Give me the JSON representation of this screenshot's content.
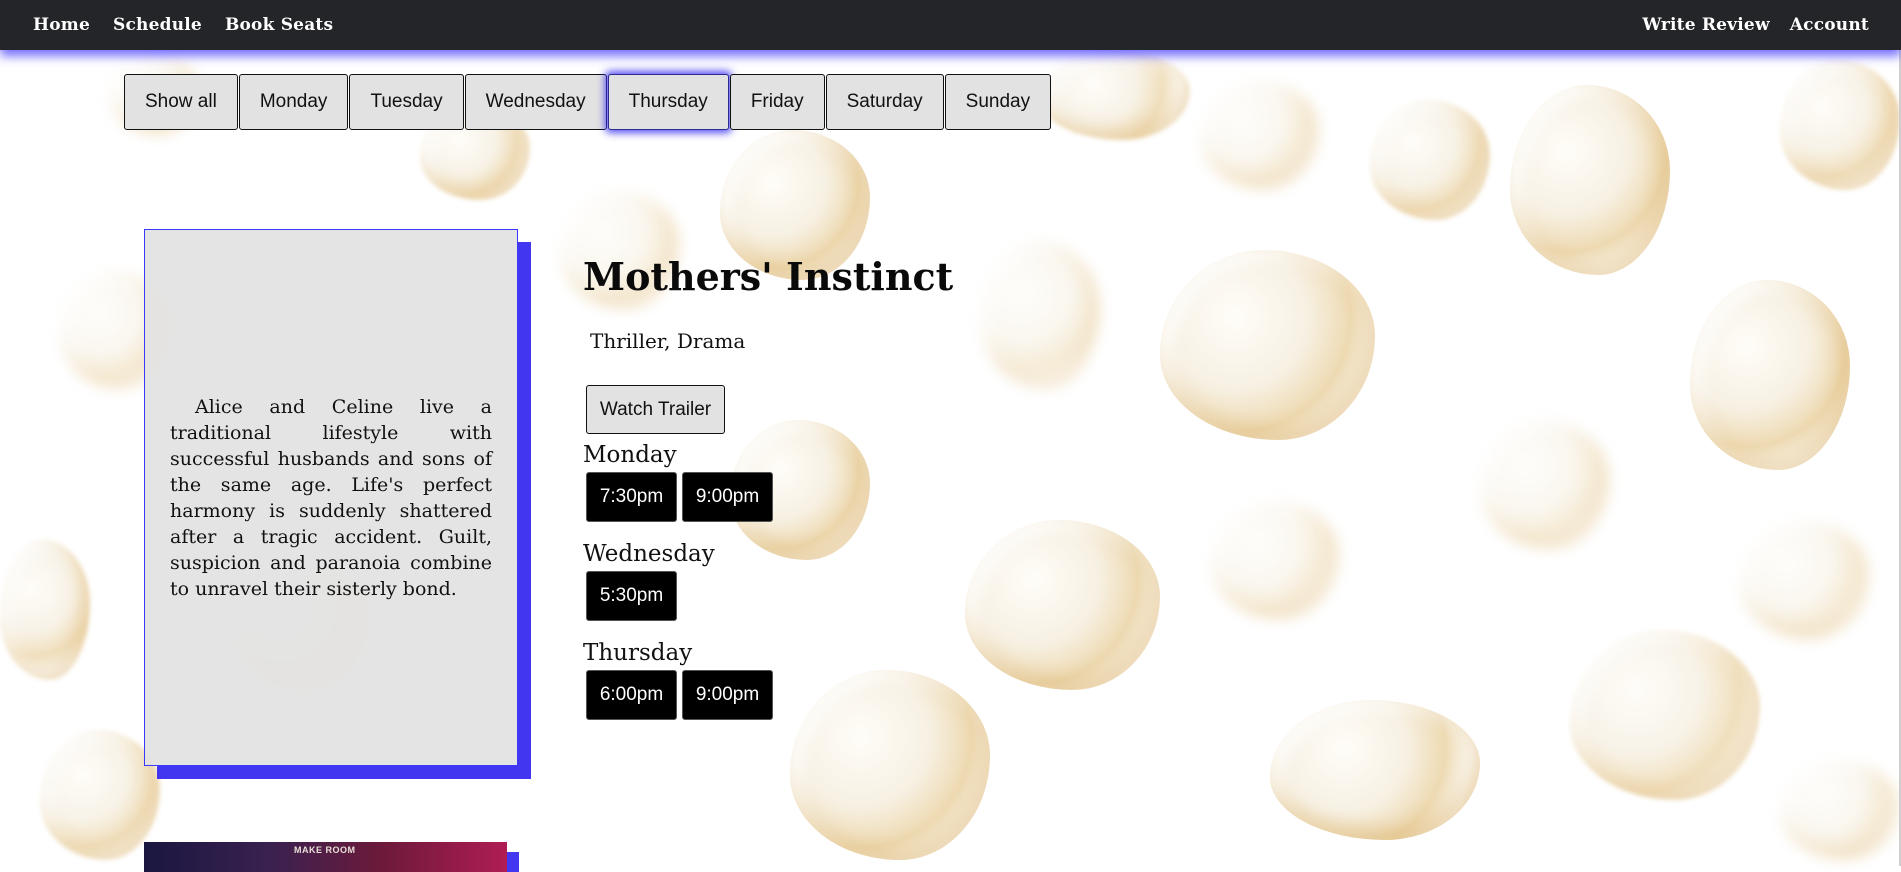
{
  "nav": {
    "left": [
      {
        "label": "Home"
      },
      {
        "label": "Schedule"
      },
      {
        "label": "Book Seats"
      }
    ],
    "right": [
      {
        "label": "Write Review"
      },
      {
        "label": "Account"
      }
    ]
  },
  "day_filter": {
    "buttons": [
      "Show all",
      "Monday",
      "Tuesday",
      "Wednesday",
      "Thursday",
      "Friday",
      "Saturday",
      "Sunday"
    ],
    "active": "Thursday"
  },
  "movie": {
    "title": "Mothers' Instinct",
    "genre": "Thriller, Drama",
    "synopsis": "Alice and Celine live a traditional lifestyle with successful husbands and sons of the same age. Life's perfect harmony is suddenly shattered after a tragic accident. Guilt, suspicion and paranoia combine to unravel their sisterly bond.",
    "trailer_label": "Watch Trailer",
    "showings": [
      {
        "day": "Monday",
        "times": [
          "7:30pm",
          "9:00pm"
        ]
      },
      {
        "day": "Wednesday",
        "times": [
          "5:30pm"
        ]
      },
      {
        "day": "Thursday",
        "times": [
          "6:00pm",
          "9:00pm"
        ]
      }
    ]
  },
  "next_poster_text": "MAKE ROOM",
  "colors": {
    "nav_bg": "#242529",
    "accent_shadow": "#4336f0",
    "button_bg": "#e2e2e2",
    "time_button_bg": "#000000"
  }
}
